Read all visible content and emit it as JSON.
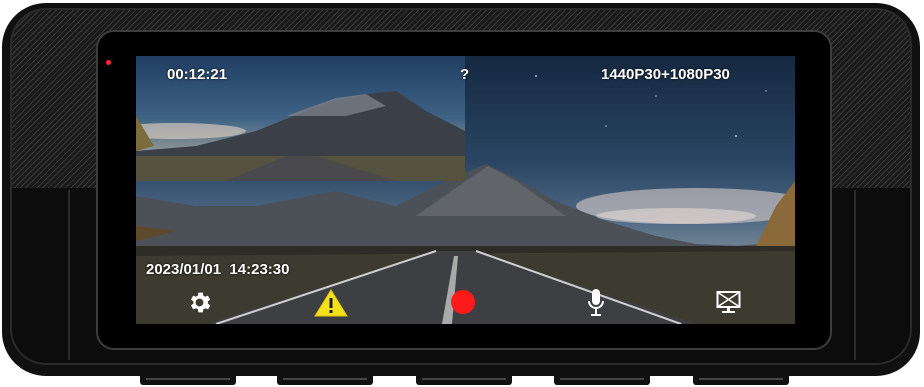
{
  "osd": {
    "elapsed_time": "00:12:21",
    "status_mark": "?",
    "resolution": "1440P30+1080P30",
    "date": "2023/01/01",
    "clock": "14:23:30"
  },
  "toolbar": {
    "settings_icon": "gear-icon",
    "emergency_icon": "warning-triangle-icon",
    "record_icon": "record-dot-icon",
    "microphone_icon": "microphone-icon",
    "screen_off_icon": "screen-off-icon"
  },
  "colors": {
    "record": "#ff1a1a",
    "warning": "#f4e11e",
    "led": "#ff2a2a",
    "osd_text": "#ffffff"
  }
}
